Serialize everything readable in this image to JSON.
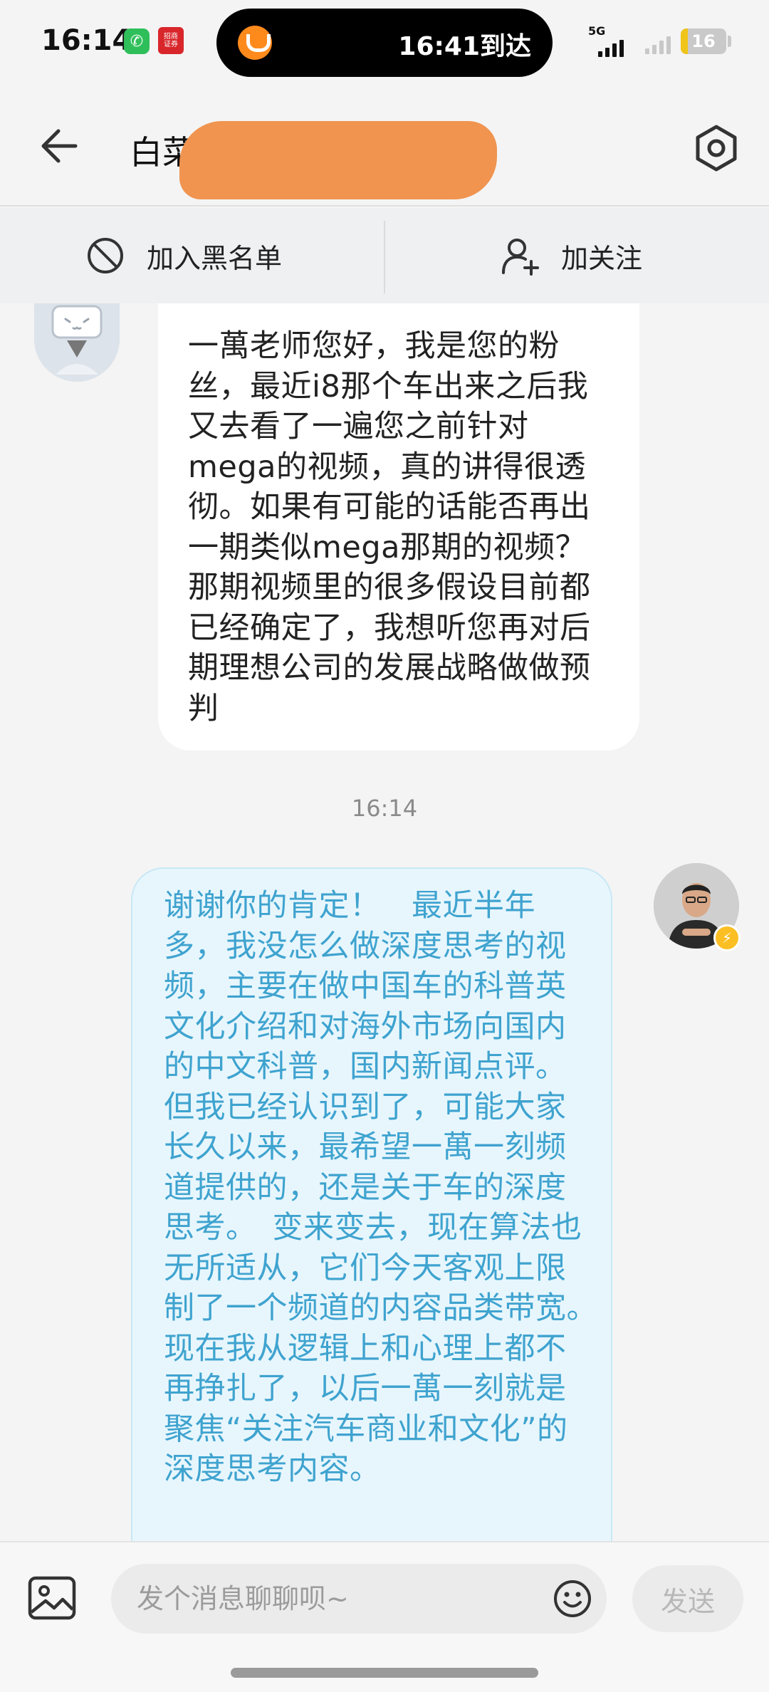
{
  "status_bar": {
    "time": "16:14",
    "app1_glyph": "✆",
    "app2_line1": "招商",
    "app2_line2": "证券",
    "island_text": "16:41到达",
    "network": "5G",
    "battery": "16",
    "battery_level": 0.16
  },
  "header": {
    "title": "白菜",
    "icons": {
      "back": "back-arrow-icon",
      "settings": "settings-hexagon-icon"
    }
  },
  "actions": {
    "block_label": "加入黑名单",
    "follow_label": "加关注"
  },
  "messages": {
    "incoming_text": "一萬老师您好，我是您的粉丝，最近i8那个车出来之后我又去看了一遍您之前针对mega的视频，真的讲得很透彻。如果有可能的话能否再出一期类似mega那期的视频？那期视频里的很多假设目前都已经确定了，我想听您再对后期理想公司的发展战略做做预判",
    "timestamp": "16:14",
    "outgoing_text": "谢谢你的肯定！　最近半年多，我没怎么做深度思考的视频，主要在做中国车的科普英文化介绍和对海外市场向国内的中文科普，国内新闻点评。但我已经认识到了，可能大家长久以来，最希望一萬一刻频道提供的，还是关于车的深度思考。　变来变去，现在算法也无所适从，它们今天客观上限制了一个频道的内容品类带宽。　现在我从逻辑上和心理上都不再挣扎了，以后一萬一刻就是聚焦“关注汽车商业和文化”的深度思考内容。",
    "vip_badge": "⚡"
  },
  "input": {
    "placeholder": "发个消息聊聊呗~",
    "send_label": "发送"
  },
  "colors": {
    "outgoing_text": "#3fa3cf",
    "outgoing_bg": "#e7f6fd",
    "redaction": "#f0944f",
    "island_logo": "#ff8a1c"
  }
}
